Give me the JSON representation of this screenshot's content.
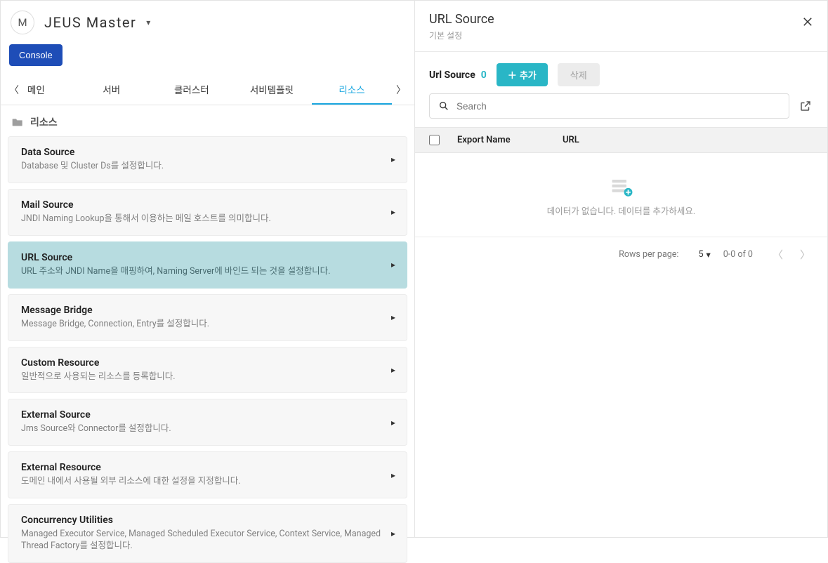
{
  "header": {
    "avatar_letter": "M",
    "title": "JEUS  Master"
  },
  "console_label": "Console",
  "tabs": {
    "t0": "메인",
    "t1": "서버",
    "t2": "클러스터",
    "t3": "서비템플릿",
    "t4": "리소스"
  },
  "section_title": "리소스",
  "cards": [
    {
      "title": "Data Source",
      "desc": "Database 및 Cluster Ds를 설정합니다."
    },
    {
      "title": "Mail Source",
      "desc": "JNDI Naming Lookup을 통해서 이용하는 메일 호스트를 의미합니다."
    },
    {
      "title": "URL Source",
      "desc": "URL 주소와 JNDI Name을 매핑하여, Naming Server에 바인드 되는 것을 설정합니다."
    },
    {
      "title": "Message Bridge",
      "desc": "Message Bridge, Connection, Entry를 설정합니다."
    },
    {
      "title": "Custom Resource",
      "desc": "일반적으로 사용되는 리소스를 등록합니다."
    },
    {
      "title": "External Source",
      "desc": "Jms Source와 Connector를 설정합니다."
    },
    {
      "title": "External Resource",
      "desc": "도메인 내에서 사용될 외부 리소스에 대한 설정을 지정합니다."
    },
    {
      "title": "Concurrency Utilities",
      "desc": "Managed Executor Service, Managed Scheduled Executor Service, Context Service, Managed Thread Factory를 설정합니다."
    }
  ],
  "right": {
    "title": "URL Source",
    "subtitle": "기본 설정",
    "label": "Url Source",
    "count": "0",
    "add_label": "추가",
    "delete_label": "삭제",
    "search_placeholder": "Search",
    "columns": {
      "export": "Export Name",
      "url": "URL"
    },
    "empty_text": "데이터가 없습니다. 데이터를 추가하세요.",
    "pager": {
      "rpp_label": "Rows per page:",
      "rpp_value": "5",
      "range": "0-0 of 0"
    }
  }
}
